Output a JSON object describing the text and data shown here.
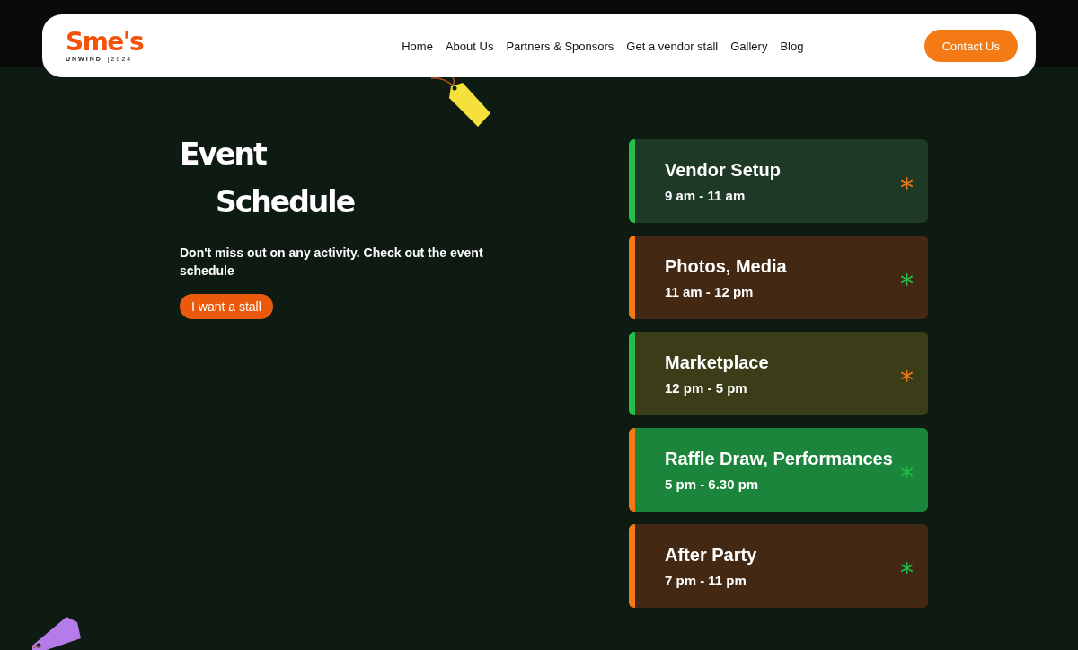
{
  "logo": {
    "name": "Sme's",
    "tagline": "UNWIND",
    "year": "|2024"
  },
  "nav": {
    "links": [
      {
        "label": "Home"
      },
      {
        "label": "About Us"
      },
      {
        "label": "Partners & Sponsors"
      },
      {
        "label": "Get a vendor stall"
      },
      {
        "label": "Gallery"
      },
      {
        "label": "Blog"
      }
    ],
    "cta": "Contact Us"
  },
  "hero": {
    "title_line1": "Event",
    "title_line2": "Schedule",
    "description": "Don't miss out on any activity. Check out the event schedule",
    "button": "I want a stall"
  },
  "schedule": [
    {
      "title": "Vendor Setup",
      "time": "9 am - 11 am",
      "mark": "*",
      "kind": "green",
      "color": "#1e3a27"
    },
    {
      "title": "Photos, Media",
      "time": "11 am - 12 pm",
      "mark": "*",
      "kind": "orange",
      "color": "#432913"
    },
    {
      "title": "Marketplace",
      "time": "12 pm - 5 pm",
      "mark": "*",
      "kind": "green",
      "color": "#3a3d18"
    },
    {
      "title": "Raffle Draw, Performances",
      "time": "5 pm - 6.30 pm",
      "mark": "*",
      "kind": "orange",
      "color": "#1c853c"
    },
    {
      "title": "After Party",
      "time": "7 pm - 11 pm",
      "mark": "*",
      "kind": "orange",
      "color": "#432913"
    }
  ]
}
